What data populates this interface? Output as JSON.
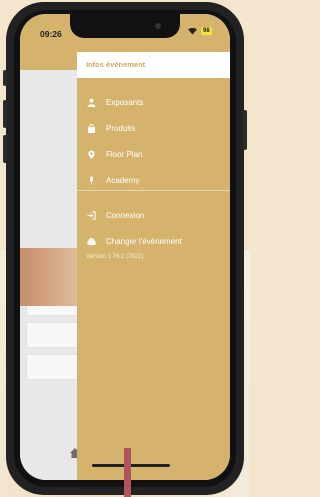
{
  "status_bar": {
    "time": "09:26",
    "battery": "98"
  },
  "drawer": {
    "header": "Infos événement",
    "items": [
      {
        "label": "Exposants",
        "icon": "people-icon"
      },
      {
        "label": "Produits",
        "icon": "bag-icon"
      },
      {
        "label": "Floor Plan",
        "icon": "map-pin-icon"
      },
      {
        "label": "Academy",
        "icon": "microphone-icon"
      }
    ],
    "secondary_items": [
      {
        "label": "Connexion",
        "icon": "login-icon"
      },
      {
        "label": "Changer l'événement",
        "icon": "switch-event-icon"
      }
    ],
    "version": "Version 1.76.2 (7822)"
  },
  "colors": {
    "accent": "#d6b36c",
    "header_text": "#d2aa5d",
    "marker": "#b0555f"
  }
}
